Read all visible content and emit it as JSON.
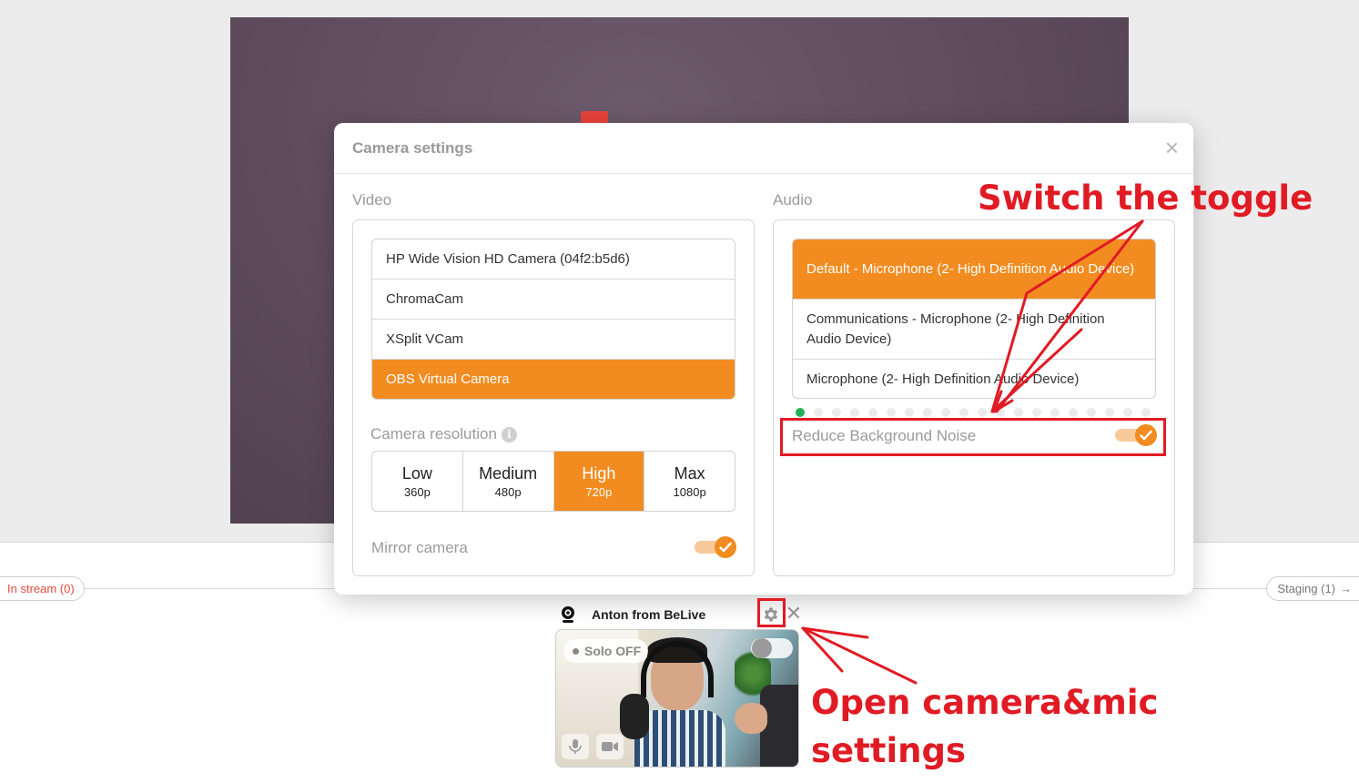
{
  "stream": {
    "in_stream_label": "In stream (0)",
    "staging_label": "Staging (1)",
    "staging_arrow": "→"
  },
  "participant": {
    "name": "Anton from BeLive",
    "solo_label": "Solo OFF",
    "close_glyph": "✕",
    "solo_enabled": false
  },
  "modal": {
    "title": "Camera settings",
    "close_glyph": "×",
    "video": {
      "section_label": "Video",
      "devices": [
        {
          "label": "HP Wide Vision HD Camera (04f2:b5d6)",
          "selected": false
        },
        {
          "label": "ChromaCam",
          "selected": false
        },
        {
          "label": "XSplit VCam",
          "selected": false
        },
        {
          "label": "OBS Virtual Camera",
          "selected": true
        }
      ],
      "resolution_label": "Camera resolution",
      "info_glyph": "i",
      "resolutions": [
        {
          "name": "Low",
          "sub": "360p",
          "selected": false
        },
        {
          "name": "Medium",
          "sub": "480p",
          "selected": false
        },
        {
          "name": "High",
          "sub": "720p",
          "selected": true
        },
        {
          "name": "Max",
          "sub": "1080p",
          "selected": false
        }
      ],
      "mirror_label": "Mirror camera",
      "mirror_enabled": true
    },
    "audio": {
      "section_label": "Audio",
      "devices": [
        {
          "label": "Default - Microphone (2- High Definition Audio Device)",
          "selected": true
        },
        {
          "label": "Communications - Microphone (2- High Definition Audio Device)",
          "selected": false
        },
        {
          "label": "Microphone (2- High Definition Audio Device)",
          "selected": false
        }
      ],
      "input_level": 0.05,
      "noise_label": "Reduce Background Noise",
      "noise_enabled": true
    }
  },
  "annotations": {
    "toggle_hint": "Switch the toggle",
    "settings_hint_line1": "Open camera&mic",
    "settings_hint_line2": "settings"
  },
  "colors": {
    "accent": "#f28c21",
    "annotation": "#e01b24",
    "level_active": "#1fb156",
    "in_stream": "#e34a3c"
  },
  "icons": {
    "webcam": "webcam-icon",
    "gear": "gear-icon",
    "close": "close-icon",
    "check": "check-icon",
    "info": "info-icon",
    "mic": "microphone-icon",
    "camera": "video-camera-icon",
    "arrow": "arrow-right-icon"
  }
}
